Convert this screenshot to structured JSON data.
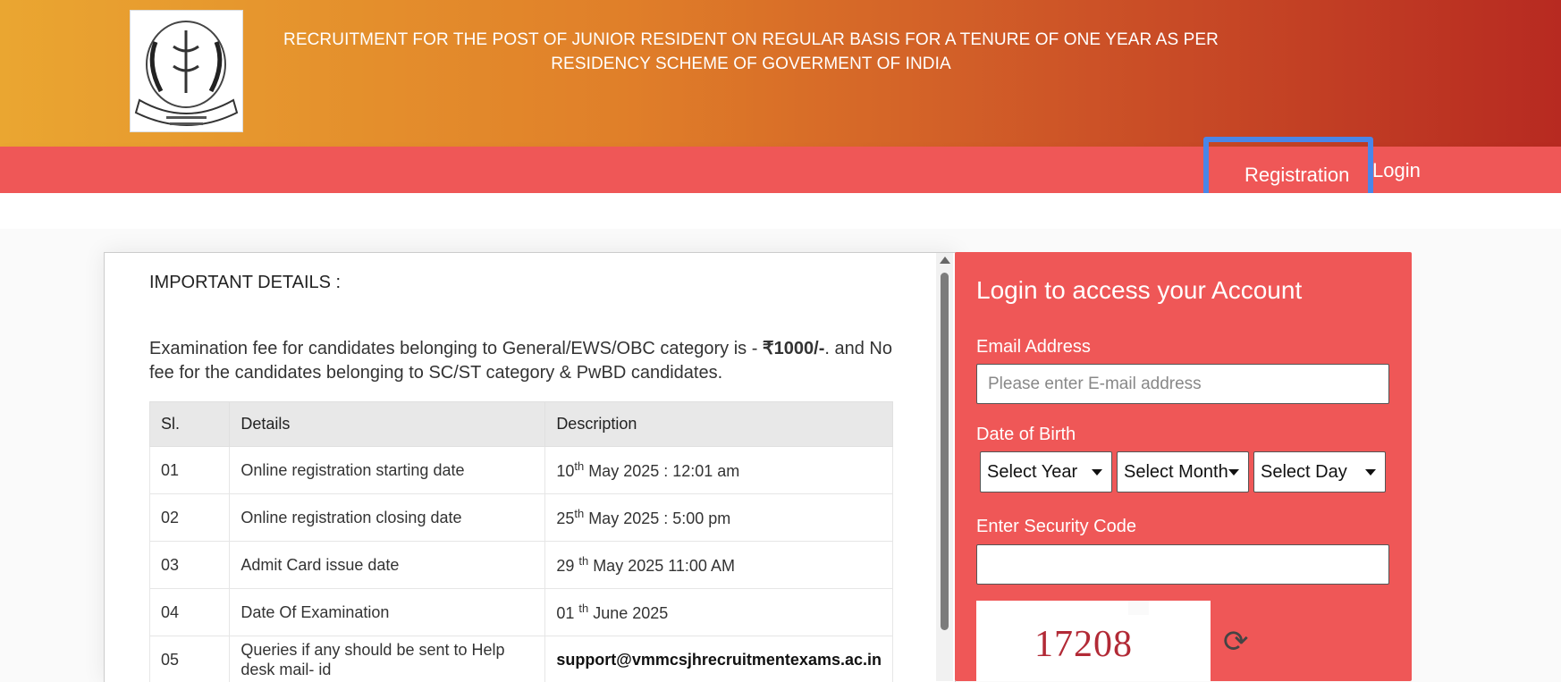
{
  "header": {
    "title": "RECRUITMENT FOR THE POST OF JUNIOR RESIDENT ON REGULAR BASIS FOR A TENURE OF ONE YEAR AS PER RESIDENCY SCHEME OF GOVERMENT OF INDIA",
    "logo_icon": "college-emblem-logo"
  },
  "nav": {
    "registration": "Registration",
    "login": "Login"
  },
  "details": {
    "heading": "IMPORTANT DETAILS :",
    "fee_text_before": "Examination fee for candidates belonging to General/EWS/OBC category is - ",
    "fee_amount": "₹1000/-",
    "fee_text_after": ". and No fee for the candidates belonging to SC/ST category & PwBD candidates.",
    "columns": [
      "Sl.",
      "Details",
      "Description"
    ],
    "rows": [
      {
        "sl": "01",
        "details": "Online registration starting date",
        "day": "10",
        "sup": "th",
        "rest": " May 2025 : 12:01 am"
      },
      {
        "sl": "02",
        "details": "Online registration closing date",
        "day": "25",
        "sup": "th",
        "rest": " May 2025 : 5:00 pm"
      },
      {
        "sl": "03",
        "details": "Admit Card issue date",
        "day": "29 ",
        "sup": "th",
        "rest": " May 2025 11:00 AM"
      },
      {
        "sl": "04",
        "details": "Date Of Examination",
        "day": "01 ",
        "sup": "th",
        "rest": " June 2025"
      },
      {
        "sl": "05",
        "details": "Queries if any should be sent to Help desk mail- id",
        "email": "support@vmmcsjhrecruitmentexams.ac.in"
      }
    ]
  },
  "login": {
    "title": "Login to access your Account",
    "email_label": "Email Address",
    "email_placeholder": "Please enter E-mail address",
    "dob_label": "Date of Birth",
    "year": "Select Year",
    "month": "Select Month",
    "day": "Select Day",
    "security_label": "Enter Security Code",
    "captcha_code": "17208",
    "refresh_icon": "refresh-icon"
  },
  "colors": {
    "nav_red": "#ef5757",
    "highlight_blue": "#4a86e8"
  }
}
